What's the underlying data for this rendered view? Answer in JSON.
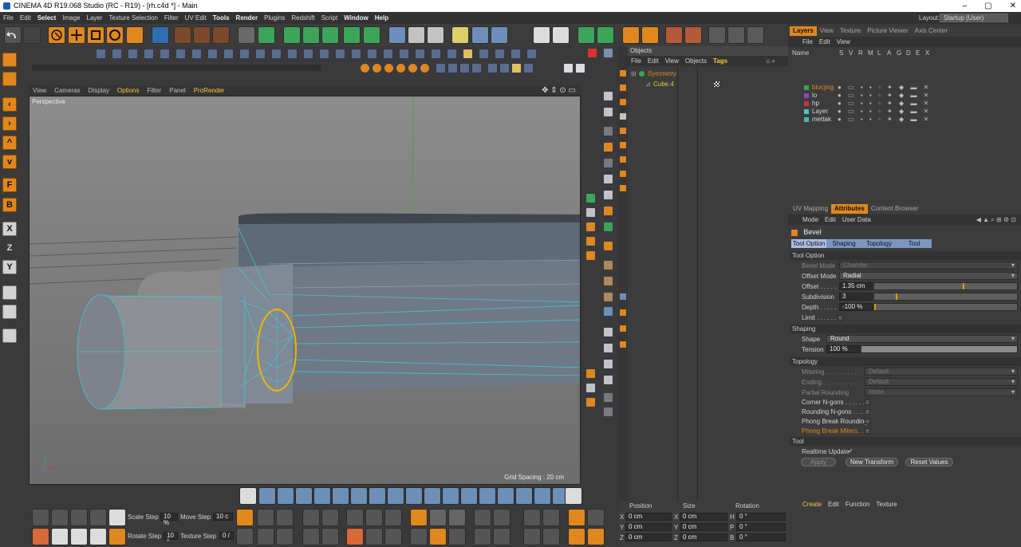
{
  "window": {
    "title": "CINEMA 4D R19.068 Studio (RC - R19) - [rh.c4d *] - Main",
    "minimize": "–",
    "maximize": "▢",
    "close": "✕"
  },
  "menu": {
    "items": [
      "File",
      "Edit",
      "Select",
      "Image",
      "Layer",
      "Texture Selection",
      "Filter",
      "UV Edit",
      "Tools",
      "Render",
      "Plugins",
      "Redshift",
      "Script",
      "Window",
      "Help"
    ],
    "layout_label": "Layout:",
    "layout_value": "Startup (User)"
  },
  "left_sidebar": {
    "letters": [
      "F",
      "B",
      "X",
      "Z",
      "Y"
    ]
  },
  "viewport": {
    "menu": [
      "View",
      "Cameras",
      "Display",
      "Options",
      "Filter",
      "Panel",
      "ProRender"
    ],
    "active_menu": "Options",
    "camera_label": "Perspective",
    "grid_spacing": "Grid Spacing : 20 cm"
  },
  "objects": {
    "title": "Objects",
    "menu": [
      "File",
      "Edit",
      "View",
      "Objects",
      "Tags"
    ],
    "items": [
      {
        "name": "Symmetry",
        "color": "#e0871e"
      },
      {
        "name": "Cube.4",
        "color": "#f3c73b"
      }
    ]
  },
  "layers": {
    "tabs": [
      "Layers",
      "View",
      "Texture",
      "Picture Viewer",
      "Axis Center"
    ],
    "menu": [
      "File",
      "Edit",
      "View"
    ],
    "columns": [
      "Name",
      "S",
      "V",
      "R",
      "M",
      "L",
      "A",
      "G",
      "D",
      "E",
      "X"
    ],
    "items": [
      {
        "name": "blocjing",
        "color": "#e0871e",
        "swatch": "#2fa84a"
      },
      {
        "name": "lo",
        "color": "#d7d7d7",
        "swatch": "#9b3dc9"
      },
      {
        "name": "hp",
        "color": "#d7d7d7",
        "swatch": "#c23a3a"
      },
      {
        "name": "Layer",
        "color": "#d7d7d7",
        "swatch": "#46c6c6"
      },
      {
        "name": "mettak",
        "color": "#d7d7d7",
        "swatch": "#47b8b0"
      }
    ]
  },
  "attributes": {
    "tabs": [
      "UV Mapping",
      "Attributes",
      "Content Browser"
    ],
    "menu": [
      "Mode",
      "Edit",
      "User Data"
    ],
    "tool_name": "Bevel",
    "subtabs": [
      "Tool Option",
      "Shaping",
      "Topology",
      "Tool"
    ],
    "sections": {
      "tool_option": "Tool Option",
      "shaping": "Shaping",
      "topology": "Topology",
      "tool": "Tool"
    },
    "bevel_mode": {
      "label": "Bevel Mode",
      "value": "Chamfer"
    },
    "offset_mode": {
      "label": "Offset Mode",
      "value": "Radial"
    },
    "offset": {
      "label": "Offset . . . . .",
      "value": "1.35 cm",
      "mark": 0.62
    },
    "subdivision": {
      "label": "Subdivision",
      "value": "3",
      "mark": 0.15
    },
    "depth": {
      "label": "Depth . . . . .",
      "value": "-100 %",
      "mark": 0.0
    },
    "limit": {
      "label": "Limit . . . . . ."
    },
    "shape": {
      "label": "Shape",
      "value": "Round"
    },
    "tension": {
      "label": "Tension",
      "value": "100 %",
      "fill": 1.0
    },
    "mitering": {
      "label": "Mitering . . . . . . . . . .",
      "value": "Default"
    },
    "ending": {
      "label": "Ending. . . . . . . . . . . .",
      "value": "Default"
    },
    "partial_rounding": {
      "label": "Partial Rounding",
      "value": "None"
    },
    "corner_ngons": {
      "label": "Corner N-gons . . . . . ."
    },
    "rounding_ngons": {
      "label": "Rounding N-gons . . . ."
    },
    "phong_break_rounding": {
      "label": "Phong Break Rounding"
    },
    "phong_break_miters": {
      "label": "Phong Break Miters. . . ."
    },
    "realtime_update": {
      "label": "Realtime Update",
      "check": "✓"
    },
    "apply": "Apply",
    "new_transform": "New Transform",
    "reset_values": "Reset Values"
  },
  "bottom_toolbar": {
    "scale_step_label": "Scale Step",
    "scale_step_value": "10 %",
    "move_step_label": "Move Step",
    "move_step_value": "10 c",
    "rotate_step_label": "Rotate Step",
    "rotate_step_value": "10 °",
    "texture_step_label": "Texture Step",
    "texture_step_value": "0 /"
  },
  "coordinates": {
    "headers": [
      "Position",
      "Size",
      "Rotation"
    ],
    "rows": [
      {
        "axis": "X",
        "pos": "0 cm",
        "saxis": "X",
        "size": "0 cm",
        "raxis": "H",
        "rot": "0 °"
      },
      {
        "axis": "Y",
        "pos": "0 cm",
        "saxis": "Y",
        "size": "0 cm",
        "raxis": "P",
        "rot": "0 °"
      },
      {
        "axis": "Z",
        "pos": "0 cm",
        "saxis": "Z",
        "size": "0 cm",
        "raxis": "B",
        "rot": "0 °"
      }
    ]
  },
  "material": {
    "menu": [
      "Create",
      "Edit",
      "Function",
      "Texture"
    ]
  }
}
